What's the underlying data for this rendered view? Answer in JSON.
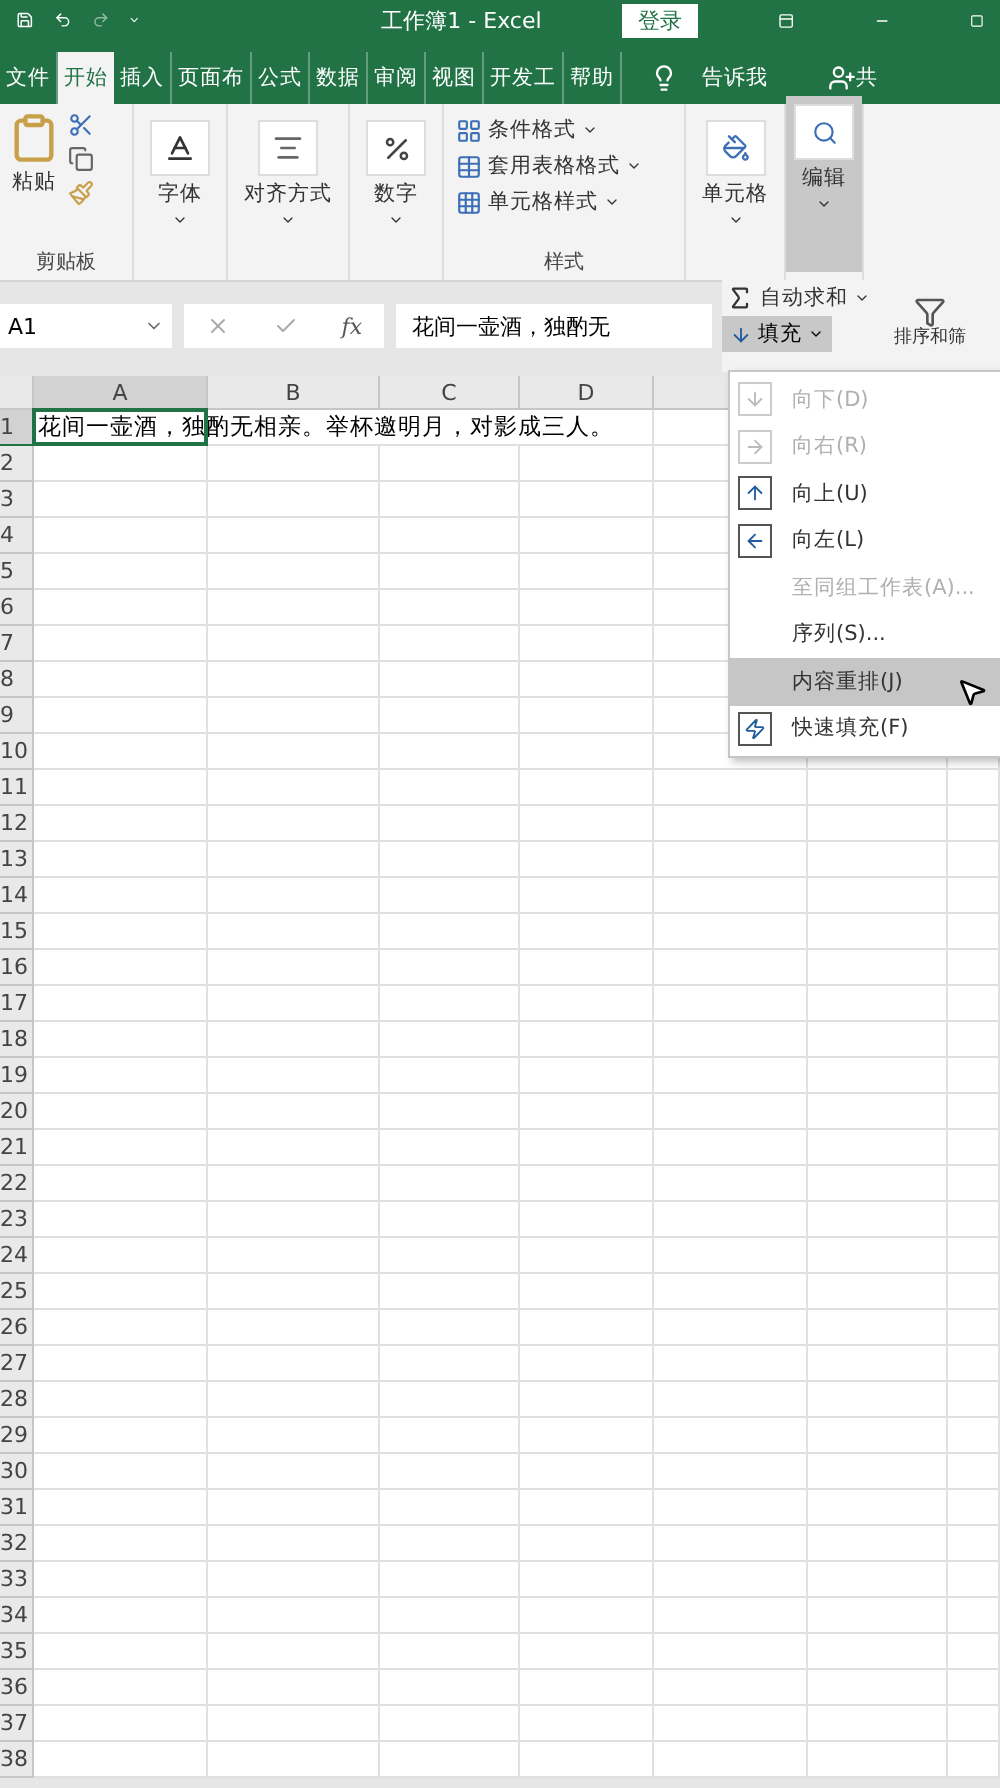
{
  "title_bar": {
    "title": "工作簿1  -  Excel",
    "sign_in": "登录"
  },
  "tabs": [
    {
      "label": "文件",
      "selected": false
    },
    {
      "label": "开始",
      "selected": true
    },
    {
      "label": "插入",
      "selected": false
    },
    {
      "label": "页面布",
      "selected": false
    },
    {
      "label": "公式",
      "selected": false
    },
    {
      "label": "数据",
      "selected": false
    },
    {
      "label": "审阅",
      "selected": false
    },
    {
      "label": "视图",
      "selected": false
    },
    {
      "label": "开发工",
      "selected": false
    },
    {
      "label": "帮助",
      "selected": false
    }
  ],
  "tell_me": "告诉我",
  "share": "共",
  "ribbon": {
    "clipboard": {
      "paste": "粘贴",
      "label": "剪贴板"
    },
    "groups": [
      {
        "kind": "font",
        "label": "字体"
      },
      {
        "kind": "align",
        "label": "对齐方式"
      },
      {
        "kind": "number",
        "label": "数字"
      }
    ],
    "styles": {
      "items": [
        {
          "kind": "conditional",
          "label": "条件格式"
        },
        {
          "kind": "table",
          "label": "套用表格格式"
        },
        {
          "kind": "cell",
          "label": "单元格样式"
        }
      ],
      "label": "样式"
    },
    "cells": {
      "label": "单元格"
    },
    "editing": {
      "label": "编辑",
      "expanded": true
    }
  },
  "formula_bar": {
    "name_box": "A1",
    "function_symbol": "fx",
    "value": "花间一壶酒，独酌无"
  },
  "editing_panel": {
    "autosum": "自动求和",
    "fill": {
      "label": "填充",
      "selected": true
    },
    "sort": "排序和筛"
  },
  "fill_menu": [
    {
      "kind": "down",
      "label": "向下(D)",
      "disabled": true,
      "selected": false
    },
    {
      "kind": "right",
      "label": "向右(R)",
      "disabled": true,
      "selected": false
    },
    {
      "kind": "up",
      "label": "向上(U)",
      "disabled": false,
      "selected": false
    },
    {
      "kind": "left",
      "label": "向左(L)",
      "disabled": false,
      "selected": false
    },
    {
      "kind": "none",
      "label": "至同组工作表(A)...",
      "disabled": true,
      "selected": false
    },
    {
      "kind": "none",
      "label": "序列(S)...",
      "disabled": false,
      "selected": false
    },
    {
      "kind": "none",
      "label": "内容重排(J)",
      "disabled": false,
      "selected": true
    },
    {
      "kind": "flash",
      "label": "快速填充(F)",
      "disabled": false,
      "selected": false
    }
  ],
  "sheet": {
    "columns": [
      "A",
      "B",
      "C",
      "D"
    ],
    "rows": [
      "1",
      "2",
      "3",
      "4",
      "5",
      "6",
      "7",
      "8",
      "9",
      "10",
      "11",
      "12",
      "13",
      "14",
      "15",
      "16",
      "17",
      "18",
      "19",
      "20",
      "21",
      "22",
      "23",
      "24",
      "25",
      "26",
      "27",
      "28",
      "29",
      "30",
      "31",
      "32",
      "33",
      "34",
      "35",
      "36",
      "37",
      "38"
    ],
    "cells": [
      {
        "text": "花间一壶酒，独酌无相亲。举杯邀明月，对影成三人。",
        "selected": true
      }
    ]
  }
}
